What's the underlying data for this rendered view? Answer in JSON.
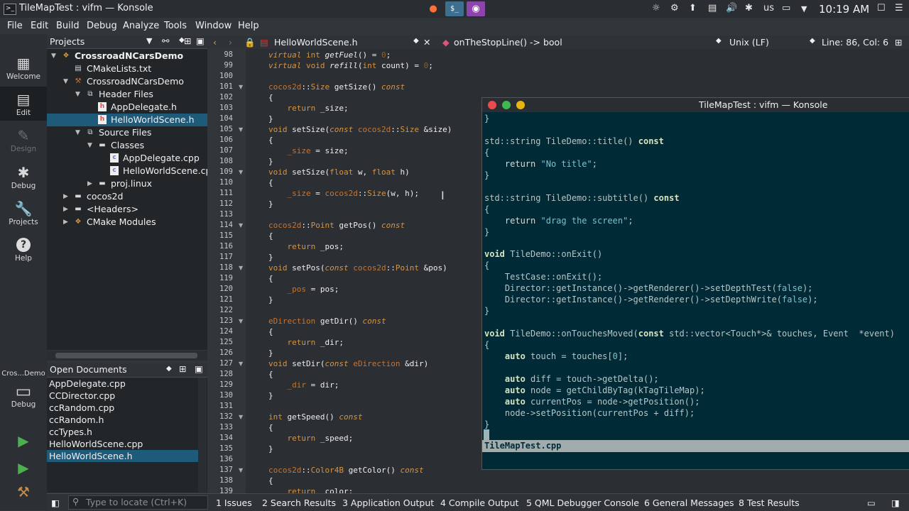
{
  "window_title": "TileMapTest : vifm — Konsole",
  "app_icon_glyph": ">_",
  "taskbar": {
    "firefox": "●",
    "konsole": "$_",
    "app3": "◉"
  },
  "tray": {
    "lang": "us",
    "clock": "10:19 AM"
  },
  "menu": [
    "File",
    "Edit",
    "Build",
    "Debug",
    "Analyze",
    "Tools",
    "Window",
    "Help"
  ],
  "modes": [
    {
      "label": "Welcome",
      "icon": "▦"
    },
    {
      "label": "Edit",
      "icon": "▤"
    },
    {
      "label": "Design",
      "icon": "✎"
    },
    {
      "label": "Debug",
      "icon": "✱"
    },
    {
      "label": "Projects",
      "icon": "🔧"
    },
    {
      "label": "Help",
      "icon": "?"
    }
  ],
  "kit": {
    "name": "Cros...Demo",
    "mode": "Debug",
    "monitor_icon": "▭"
  },
  "projects": {
    "header": "Projects",
    "tree": [
      {
        "label": "CrossroadNCarsDemo",
        "depth": 0,
        "arrow": "▼",
        "icon": "❖",
        "bold": true
      },
      {
        "label": "CMakeLists.txt",
        "depth": 1,
        "arrow": "",
        "icon": "▤"
      },
      {
        "label": "CrossroadNCarsDemo",
        "depth": 1,
        "arrow": "▼",
        "icon": "⚒"
      },
      {
        "label": "Header Files",
        "depth": 2,
        "arrow": "▼",
        "icon": "⧉"
      },
      {
        "label": "AppDelegate.h",
        "depth": 3,
        "arrow": "",
        "icon": "h"
      },
      {
        "label": "HelloWorldScene.h",
        "depth": 3,
        "arrow": "",
        "icon": "h",
        "selected": true
      },
      {
        "label": "Source Files",
        "depth": 2,
        "arrow": "▼",
        "icon": "⧉"
      },
      {
        "label": "Classes",
        "depth": 3,
        "arrow": "▼",
        "icon": "▬"
      },
      {
        "label": "AppDelegate.cpp",
        "depth": 4,
        "arrow": "",
        "icon": "c"
      },
      {
        "label": "HelloWorldScene.cpp",
        "depth": 4,
        "arrow": "",
        "icon": "c"
      },
      {
        "label": "proj.linux",
        "depth": 3,
        "arrow": "▶",
        "icon": "▬"
      },
      {
        "label": "cocos2d",
        "depth": 1,
        "arrow": "▶",
        "icon": "▬"
      },
      {
        "label": "<Headers>",
        "depth": 1,
        "arrow": "▶",
        "icon": "▬"
      },
      {
        "label": "CMake Modules",
        "depth": 1,
        "arrow": "▶",
        "icon": "❖"
      }
    ]
  },
  "open_documents": {
    "header": "Open Documents",
    "items": [
      "AppDelegate.cpp",
      "CCDirector.cpp",
      "ccRandom.cpp",
      "ccRandom.h",
      "ccTypes.h",
      "HelloWorldScene.cpp",
      "HelloWorldScene.h"
    ],
    "selected": "HelloWorldScene.h"
  },
  "editor": {
    "file": "HelloWorldScene.h",
    "symbol": "onTheStopLine() -> bool",
    "line_ending": "Unix (LF)",
    "position": "Line: 86, Col: 6",
    "lines": [
      {
        "n": "98",
        "f": "",
        "t": "<span class=\"kw it\">virtual</span> <span class=\"kw\">int</span> <span class=\"it\">getFuel</span>() = <span class=\"nm\">0</span>;"
      },
      {
        "n": "99",
        "f": "",
        "t": "<span class=\"kw it\">virtual</span> <span class=\"kw\">void</span> <span class=\"it\">refill</span>(<span class=\"kw\">int</span> count) = <span class=\"nm\">0</span>;"
      },
      {
        "n": "100",
        "f": "",
        "t": ""
      },
      {
        "n": "101",
        "f": "▼",
        "t": "<span class=\"cn\">cocos2d</span>::<span class=\"kw\">Size</span> getSize() <span class=\"kw it\">const</span>"
      },
      {
        "n": "102",
        "f": "",
        "t": "{"
      },
      {
        "n": "103",
        "f": "",
        "t": "    <span class=\"kw\">return</span> _size;"
      },
      {
        "n": "104",
        "f": "",
        "t": "}"
      },
      {
        "n": "105",
        "f": "▼",
        "t": "<span class=\"kw\">void</span> setSize(<span class=\"kw it\">const</span> <span class=\"cn\">cocos2d</span>::<span class=\"kw\">Size</span> &amp;size)"
      },
      {
        "n": "106",
        "f": "",
        "t": "{"
      },
      {
        "n": "107",
        "f": "",
        "t": "    <span class=\"cn\">_size</span> = size;"
      },
      {
        "n": "108",
        "f": "",
        "t": "}"
      },
      {
        "n": "109",
        "f": "▼",
        "t": "<span class=\"kw\">void</span> setSize(<span class=\"kw\">float</span> w, <span class=\"kw\">float</span> h)"
      },
      {
        "n": "110",
        "f": "",
        "t": "{"
      },
      {
        "n": "111",
        "f": "",
        "t": "    <span class=\"cn\">_size</span> = <span class=\"cn\">cocos2d</span>::<span class=\"kw\">Size</span>(w, h);"
      },
      {
        "n": "112",
        "f": "",
        "t": "}"
      },
      {
        "n": "113",
        "f": "",
        "t": ""
      },
      {
        "n": "114",
        "f": "▼",
        "t": "<span class=\"cn\">cocos2d</span>::<span class=\"kw\">Point</span> getPos() <span class=\"kw it\">const</span>"
      },
      {
        "n": "115",
        "f": "",
        "t": "{"
      },
      {
        "n": "116",
        "f": "",
        "t": "    <span class=\"kw\">return</span> _pos;"
      },
      {
        "n": "117",
        "f": "",
        "t": "}"
      },
      {
        "n": "118",
        "f": "▼",
        "t": "<span class=\"kw\">void</span> setPos(<span class=\"kw it\">const</span> <span class=\"cn\">cocos2d</span>::<span class=\"kw\">Point</span> &amp;pos)"
      },
      {
        "n": "119",
        "f": "",
        "t": "{"
      },
      {
        "n": "120",
        "f": "",
        "t": "    <span class=\"cn\">_pos</span> = pos;"
      },
      {
        "n": "121",
        "f": "",
        "t": "}"
      },
      {
        "n": "122",
        "f": "",
        "t": ""
      },
      {
        "n": "123",
        "f": "▼",
        "t": "<span class=\"cn\">eDirection</span> getDir() <span class=\"kw it\">const</span>"
      },
      {
        "n": "124",
        "f": "",
        "t": "{"
      },
      {
        "n": "125",
        "f": "",
        "t": "    <span class=\"kw\">return</span> _dir;"
      },
      {
        "n": "126",
        "f": "",
        "t": "}"
      },
      {
        "n": "127",
        "f": "▼",
        "t": "<span class=\"kw\">void</span> setDir(<span class=\"kw it\">const</span> <span class=\"cn\">eDirection</span> &amp;dir)"
      },
      {
        "n": "128",
        "f": "",
        "t": "{"
      },
      {
        "n": "129",
        "f": "",
        "t": "    <span class=\"cn\">_dir</span> = dir;"
      },
      {
        "n": "130",
        "f": "",
        "t": "}"
      },
      {
        "n": "131",
        "f": "",
        "t": ""
      },
      {
        "n": "132",
        "f": "▼",
        "t": "<span class=\"kw\">int</span> getSpeed() <span class=\"kw it\">const</span>"
      },
      {
        "n": "133",
        "f": "",
        "t": "{"
      },
      {
        "n": "134",
        "f": "",
        "t": "    <span class=\"kw\">return</span> _speed;"
      },
      {
        "n": "135",
        "f": "",
        "t": "}"
      },
      {
        "n": "136",
        "f": "",
        "t": ""
      },
      {
        "n": "137",
        "f": "▼",
        "t": "<span class=\"cn\">cocos2d</span>::<span class=\"kw\">Color4B</span> getColor() <span class=\"kw it\">const</span>"
      },
      {
        "n": "138",
        "f": "",
        "t": "{"
      },
      {
        "n": "139",
        "f": "",
        "t": "    <span class=\"kw\">return</span> _color;"
      }
    ]
  },
  "konsole": {
    "title": "TileMapTest : vifm — Konsole",
    "lines": [
      "}",
      "",
      "<span class=\"kf\">std::string TileDemo::title()</span> <span class=\"kk\">const</span>",
      "{",
      "    <span class=\"kb\">return</span> <span class=\"ks\">\"No title\"</span>;",
      "}",
      "",
      "<span class=\"kf\">std::string TileDemo::subtitle()</span> <span class=\"kk\">const</span>",
      "{",
      "    <span class=\"kb\">return</span> <span class=\"ks\">\"drag the screen\"</span>;",
      "}",
      "",
      "<span class=\"kk\">void</span> TileDemo::onExit()",
      "{",
      "    TestCase::onExit();",
      "    Director::getInstance()-&gt;getRenderer()-&gt;setDepthTest(<span class=\"ks\">false</span>);",
      "    Director::getInstance()-&gt;getRenderer()-&gt;setDepthWrite(<span class=\"ks\">false</span>);",
      "}",
      "",
      "<span class=\"kk\">void</span> TileDemo::onTouchesMoved(<span class=\"kk\">const</span> std::vector&lt;Touch*&gt;&amp; touches, Event  *event)",
      "{",
      "    <span class=\"kk\">auto</span> touch = touches[<span class=\"ks\">0</span>];",
      "",
      "    <span class=\"kk\">auto</span> diff = touch-&gt;getDelta();",
      "    <span class=\"kk\">auto</span> node = getChildByTag(kTagTileMap);",
      "    <span class=\"kk\">auto</span> currentPos = node-&gt;getPosition();",
      "    node-&gt;setPosition(currentPos + diff);",
      "}"
    ],
    "status": "TileMapTest.cpp"
  },
  "bottom": {
    "locate_placeholder": "Type to locate (Ctrl+K)",
    "tabs": [
      "1  Issues",
      "2  Search Results",
      "3  Application Output",
      "4  Compile Output",
      "5  QML Debugger Console",
      "6  General Messages",
      "8  Test Results"
    ]
  }
}
